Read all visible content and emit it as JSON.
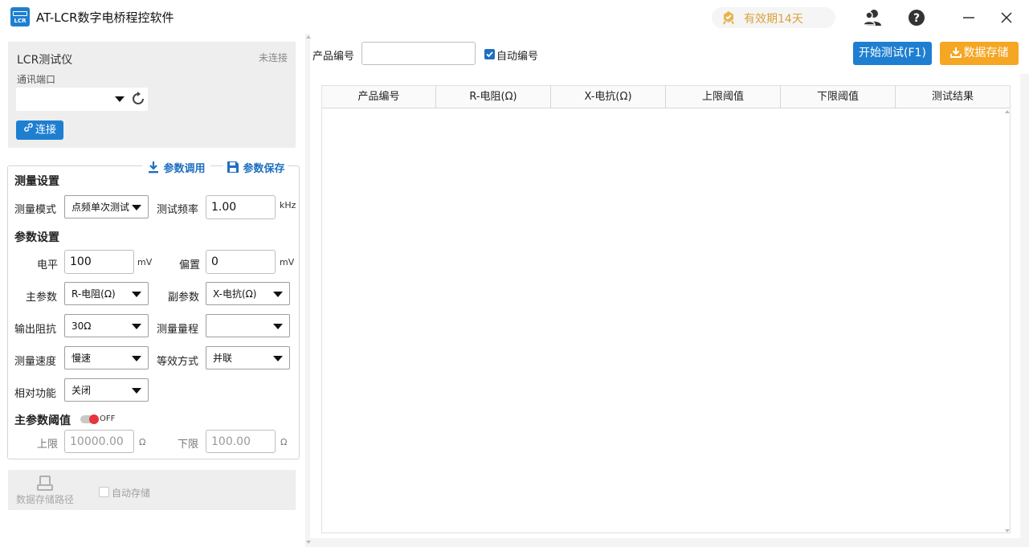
{
  "titlebar": {
    "logo_text": "LCR",
    "title": "AT-LCR数字电桥程控软件",
    "license_label": "有效期14天",
    "icons": [
      "user-group-icon",
      "help-icon",
      "minimize-icon",
      "close-icon"
    ]
  },
  "device": {
    "name": "LCR测试仪",
    "status": "未连接",
    "port_label": "通讯端口",
    "port_value": "",
    "connect_label": "连接"
  },
  "params": {
    "load_label": "参数调用",
    "save_label": "参数保存",
    "measure_section": "测量设置",
    "mode_label": "测量模式",
    "mode_value": "点频单次测试",
    "freq_label": "测试频率",
    "freq_value": "1.00",
    "freq_unit": "kHz",
    "param_section": "参数设置",
    "level_label": "电平",
    "level_value": "100",
    "level_unit": "mV",
    "bias_label": "偏置",
    "bias_value": "0",
    "bias_unit": "mV",
    "primary_label": "主参数",
    "primary_value": "R-电阻(Ω)",
    "secondary_label": "副参数",
    "secondary_value": "X-电抗(Ω)",
    "impedance_label": "输出阻抗",
    "impedance_value": "30Ω",
    "range_label": "测量量程",
    "range_value": "",
    "speed_label": "测量速度",
    "speed_value": "慢速",
    "equiv_label": "等效方式",
    "equiv_value": "并联",
    "relative_label": "相对功能",
    "relative_value": "关闭",
    "threshold_section": "主参数阈值",
    "threshold_toggle": "OFF",
    "upper_label": "上限",
    "upper_value": "10000.00",
    "upper_unit": "Ω",
    "lower_label": "下限",
    "lower_value": "100.00",
    "lower_unit": "Ω"
  },
  "storage": {
    "path_label": "数据存储路径",
    "auto_save_label": "自动存储"
  },
  "toolbar": {
    "product_label": "产品编号",
    "product_value": "",
    "auto_number_label": "自动编号",
    "start_label": "开始测试(F1)",
    "store_label": "数据存储"
  },
  "table": {
    "columns": [
      "产品编号",
      "R-电阻(Ω)",
      "X-电抗(Ω)",
      "上限阈值",
      "下限阈值",
      "测试结果"
    ]
  },
  "colors": {
    "primary": "#1e7fd1",
    "accent_orange": "#f5a623",
    "license_gold": "#d9a23a",
    "toggle_off": "#e8343f"
  }
}
